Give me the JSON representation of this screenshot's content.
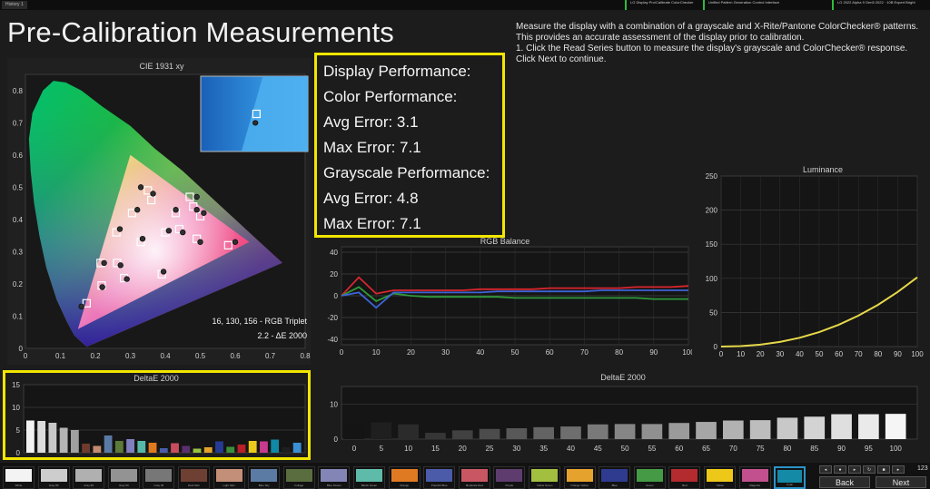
{
  "topbar": {
    "tab_label": "History 1",
    "statuses": [
      "LG Display Pro/Calibrate ColorChecker Display Plus (Retail) · OLED · (WLED)",
      "Unified Pattern Generation Control Interface",
      "LG 2022 Alpha 9 Gen5 2022 · 10B Expert Bright"
    ]
  },
  "page_title": "Pre-Calibration Measurements",
  "instructions": [
    "Measure the display with a combination of a grayscale and X-Rite/Pantone ColorChecker® patterns.",
    "This provides an accurate assessment of the display prior to calibration.",
    "1. Click the Read Series button to measure the display's grayscale and ColorChecker® response.",
    "Click Next to continue."
  ],
  "performance": {
    "display_label": "Display Performance:",
    "color_label": "Color Performance:",
    "color_avg": "Avg Error: 3.1",
    "color_max": "Max Error: 7.1",
    "grayscale_label": "Grayscale Performance:",
    "gray_avg": "Avg Error: 4.8",
    "gray_max": "Max Error: 7.1"
  },
  "colors": {
    "highlight": "#f2e600",
    "luminance_curve": "#e6d84a",
    "red": "#d8262f",
    "green": "#2f9a3a",
    "blue": "#3d63d8"
  },
  "chart_data": [
    {
      "type": "scatter",
      "title": "CIE 1931 xy",
      "xlim": [
        0,
        0.8
      ],
      "ylim": [
        0,
        0.85
      ],
      "x_ticks": [
        "0",
        "0.1",
        "0.2",
        "0.3",
        "0.4",
        "0.5",
        "0.6",
        "0.7",
        "0.8"
      ],
      "y_ticks": [
        "0",
        "0.1",
        "0.2",
        "0.3",
        "0.4",
        "0.5",
        "0.6",
        "0.7",
        "0.8"
      ],
      "gamut": [
        [
          0.64,
          0.33
        ],
        [
          0.3,
          0.6
        ],
        [
          0.15,
          0.06
        ]
      ],
      "targets": [
        [
          0.175,
          0.14
        ],
        [
          0.218,
          0.195
        ],
        [
          0.215,
          0.265
        ],
        [
          0.262,
          0.265
        ],
        [
          0.282,
          0.218
        ],
        [
          0.33,
          0.33
        ],
        [
          0.39,
          0.23
        ],
        [
          0.49,
          0.34
        ],
        [
          0.58,
          0.32
        ],
        [
          0.47,
          0.47
        ],
        [
          0.44,
          0.37
        ],
        [
          0.4,
          0.36
        ],
        [
          0.305,
          0.42
        ],
        [
          0.36,
          0.46
        ],
        [
          0.43,
          0.42
        ],
        [
          0.48,
          0.44
        ],
        [
          0.5,
          0.41
        ],
        [
          0.26,
          0.36
        ],
        [
          0.35,
          0.49
        ]
      ],
      "measured": [
        [
          0.16,
          0.13
        ],
        [
          0.22,
          0.19
        ],
        [
          0.225,
          0.265
        ],
        [
          0.272,
          0.258
        ],
        [
          0.29,
          0.215
        ],
        [
          0.335,
          0.34
        ],
        [
          0.395,
          0.238
        ],
        [
          0.5,
          0.33
        ],
        [
          0.6,
          0.33
        ],
        [
          0.49,
          0.47
        ],
        [
          0.45,
          0.36
        ],
        [
          0.41,
          0.365
        ],
        [
          0.32,
          0.43
        ],
        [
          0.365,
          0.48
        ],
        [
          0.43,
          0.43
        ],
        [
          0.49,
          0.43
        ],
        [
          0.51,
          0.42
        ],
        [
          0.27,
          0.37
        ],
        [
          0.33,
          0.5
        ]
      ],
      "inset_targets": [
        [
          0.52,
          0.5
        ]
      ],
      "inset_measured": [
        [
          0.51,
          0.38
        ]
      ],
      "readout_triplet": "16, 130, 156 - RGB Triplet",
      "readout_delta": "2.2 - ΔE 2000"
    },
    {
      "type": "bar",
      "title": "DeltaE 2000",
      "ylim": [
        0,
        15
      ],
      "y_ticks": [
        "0",
        "5",
        "10",
        "15"
      ],
      "values": [
        7.1,
        7.0,
        6.6,
        5.5,
        5.0,
        2.0,
        1.5,
        3.8,
        2.6,
        3.0,
        2.6,
        2.2,
        1.0,
        2.1,
        1.5,
        0.9,
        1.2,
        2.5,
        1.3,
        1.8,
        2.6,
        2.5,
        2.9,
        1.2,
        2.2
      ],
      "colors": [
        "#f2f2f2",
        "#dcdcdc",
        "#c8c8c8",
        "#b4b4b4",
        "#a0a0a0",
        "#6e3b2e",
        "#c48a6f",
        "#5a79a5",
        "#5c7a38",
        "#7f7fbf",
        "#56b8a6",
        "#e07a1f",
        "#4a5cab",
        "#c84d5c",
        "#5b2f6e",
        "#98c23c",
        "#e5a22a",
        "#263b94",
        "#3c8f3a",
        "#b81f26",
        "#ecca1b",
        "#c63b8e",
        "#1188a6",
        "#1f1f1f",
        "#3b8fd3"
      ]
    },
    {
      "type": "line",
      "title": "RGB Balance",
      "x": [
        0,
        5,
        10,
        15,
        20,
        25,
        30,
        35,
        40,
        45,
        50,
        55,
        60,
        65,
        70,
        75,
        80,
        85,
        90,
        95,
        100
      ],
      "xlim": [
        0,
        100
      ],
      "ylim": [
        -45,
        45
      ],
      "x_ticks": [
        "0",
        "10",
        "20",
        "30",
        "40",
        "50",
        "60",
        "70",
        "80",
        "90",
        "100"
      ],
      "y_ticks": [
        "-40",
        "-20",
        "0",
        "20",
        "40"
      ],
      "series": [
        {
          "color": "#d8262f",
          "values": [
            0,
            17,
            2,
            5,
            5,
            5,
            5,
            5,
            6,
            6,
            6,
            6,
            7,
            7,
            7,
            7,
            7,
            8,
            8,
            8,
            9
          ]
        },
        {
          "color": "#2f9a3a",
          "values": [
            0,
            8,
            -5,
            2,
            0,
            -1,
            -1,
            -1,
            -1,
            -1,
            -2,
            -2,
            -2,
            -2,
            -2,
            -2,
            -2,
            -2,
            -3,
            -3,
            -3
          ]
        },
        {
          "color": "#3d63d8",
          "values": [
            0,
            3,
            -11,
            3,
            3,
            3,
            3,
            3,
            3,
            4,
            4,
            4,
            4,
            4,
            4,
            5,
            5,
            5,
            5,
            5,
            5
          ]
        }
      ]
    },
    {
      "type": "line",
      "title": "Luminance",
      "xlim": [
        0,
        100
      ],
      "ylim": [
        0,
        250
      ],
      "x_ticks": [
        "0",
        "10",
        "20",
        "30",
        "40",
        "50",
        "60",
        "70",
        "80",
        "90",
        "100"
      ],
      "y_ticks": [
        "0",
        "50",
        "100",
        "150",
        "200",
        "250"
      ],
      "x": [
        0,
        10,
        20,
        30,
        40,
        50,
        60,
        70,
        80,
        90,
        100
      ],
      "values": [
        0,
        0.6,
        2.8,
        6.8,
        12.9,
        21.2,
        32,
        45.3,
        61.2,
        80,
        101.5
      ]
    },
    {
      "type": "bar",
      "title": "DeltaE 2000",
      "ylim": [
        0,
        15
      ],
      "y_ticks": [
        "0",
        "10"
      ],
      "categories": [
        "0",
        "5",
        "10",
        "15",
        "20",
        "25",
        "30",
        "35",
        "40",
        "45",
        "50",
        "55",
        "60",
        "65",
        "70",
        "75",
        "80",
        "85",
        "90",
        "95",
        "100"
      ],
      "values": [
        3.8,
        4.8,
        4.2,
        1.8,
        2.5,
        2.9,
        3.1,
        3.4,
        3.6,
        4.2,
        4.3,
        4.3,
        4.6,
        4.9,
        5.3,
        5.4,
        6.1,
        6.4,
        7.1,
        7.1,
        7.2
      ]
    }
  ],
  "swatches": [
    {
      "label": "White",
      "color": "#f3f3f3"
    },
    {
      "label": "Gray 80",
      "color": "#cdcdcd"
    },
    {
      "label": "Gray 65",
      "color": "#b0b0b0"
    },
    {
      "label": "Gray 50",
      "color": "#939393"
    },
    {
      "label": "Gray 35",
      "color": "#777777"
    },
    {
      "label": "Dark Skin",
      "color": "#6e4033"
    },
    {
      "label": "Light Skin",
      "color": "#c48f78"
    },
    {
      "label": "Blue Sky",
      "color": "#5c7ba4"
    },
    {
      "label": "Foliage",
      "color": "#5a6d3e"
    },
    {
      "label": "Blue Flower",
      "color": "#8385b6"
    },
    {
      "label": "Bluish Green",
      "color": "#5fbba9"
    },
    {
      "label": "Orange",
      "color": "#e07a22"
    },
    {
      "label": "Purplish Blue",
      "color": "#4b5ba9"
    },
    {
      "label": "Moderate Red",
      "color": "#c85663"
    },
    {
      "label": "Purple",
      "color": "#5f3c6e"
    },
    {
      "label": "Yellow Green",
      "color": "#a2bf40"
    },
    {
      "label": "Orange Yellow",
      "color": "#e5a32e"
    },
    {
      "label": "Blue",
      "color": "#2e3b8f"
    },
    {
      "label": "Green",
      "color": "#449a45"
    },
    {
      "label": "Red",
      "color": "#b32a2f"
    },
    {
      "label": "Yellow",
      "color": "#edc819"
    },
    {
      "label": "Magenta",
      "color": "#c2508e"
    },
    {
      "label": "Cyan",
      "color": "#148aa6"
    }
  ],
  "active_swatch": "Cyan",
  "controls": {
    "back_label": "Back",
    "next_label": "Next",
    "counter": "123"
  }
}
